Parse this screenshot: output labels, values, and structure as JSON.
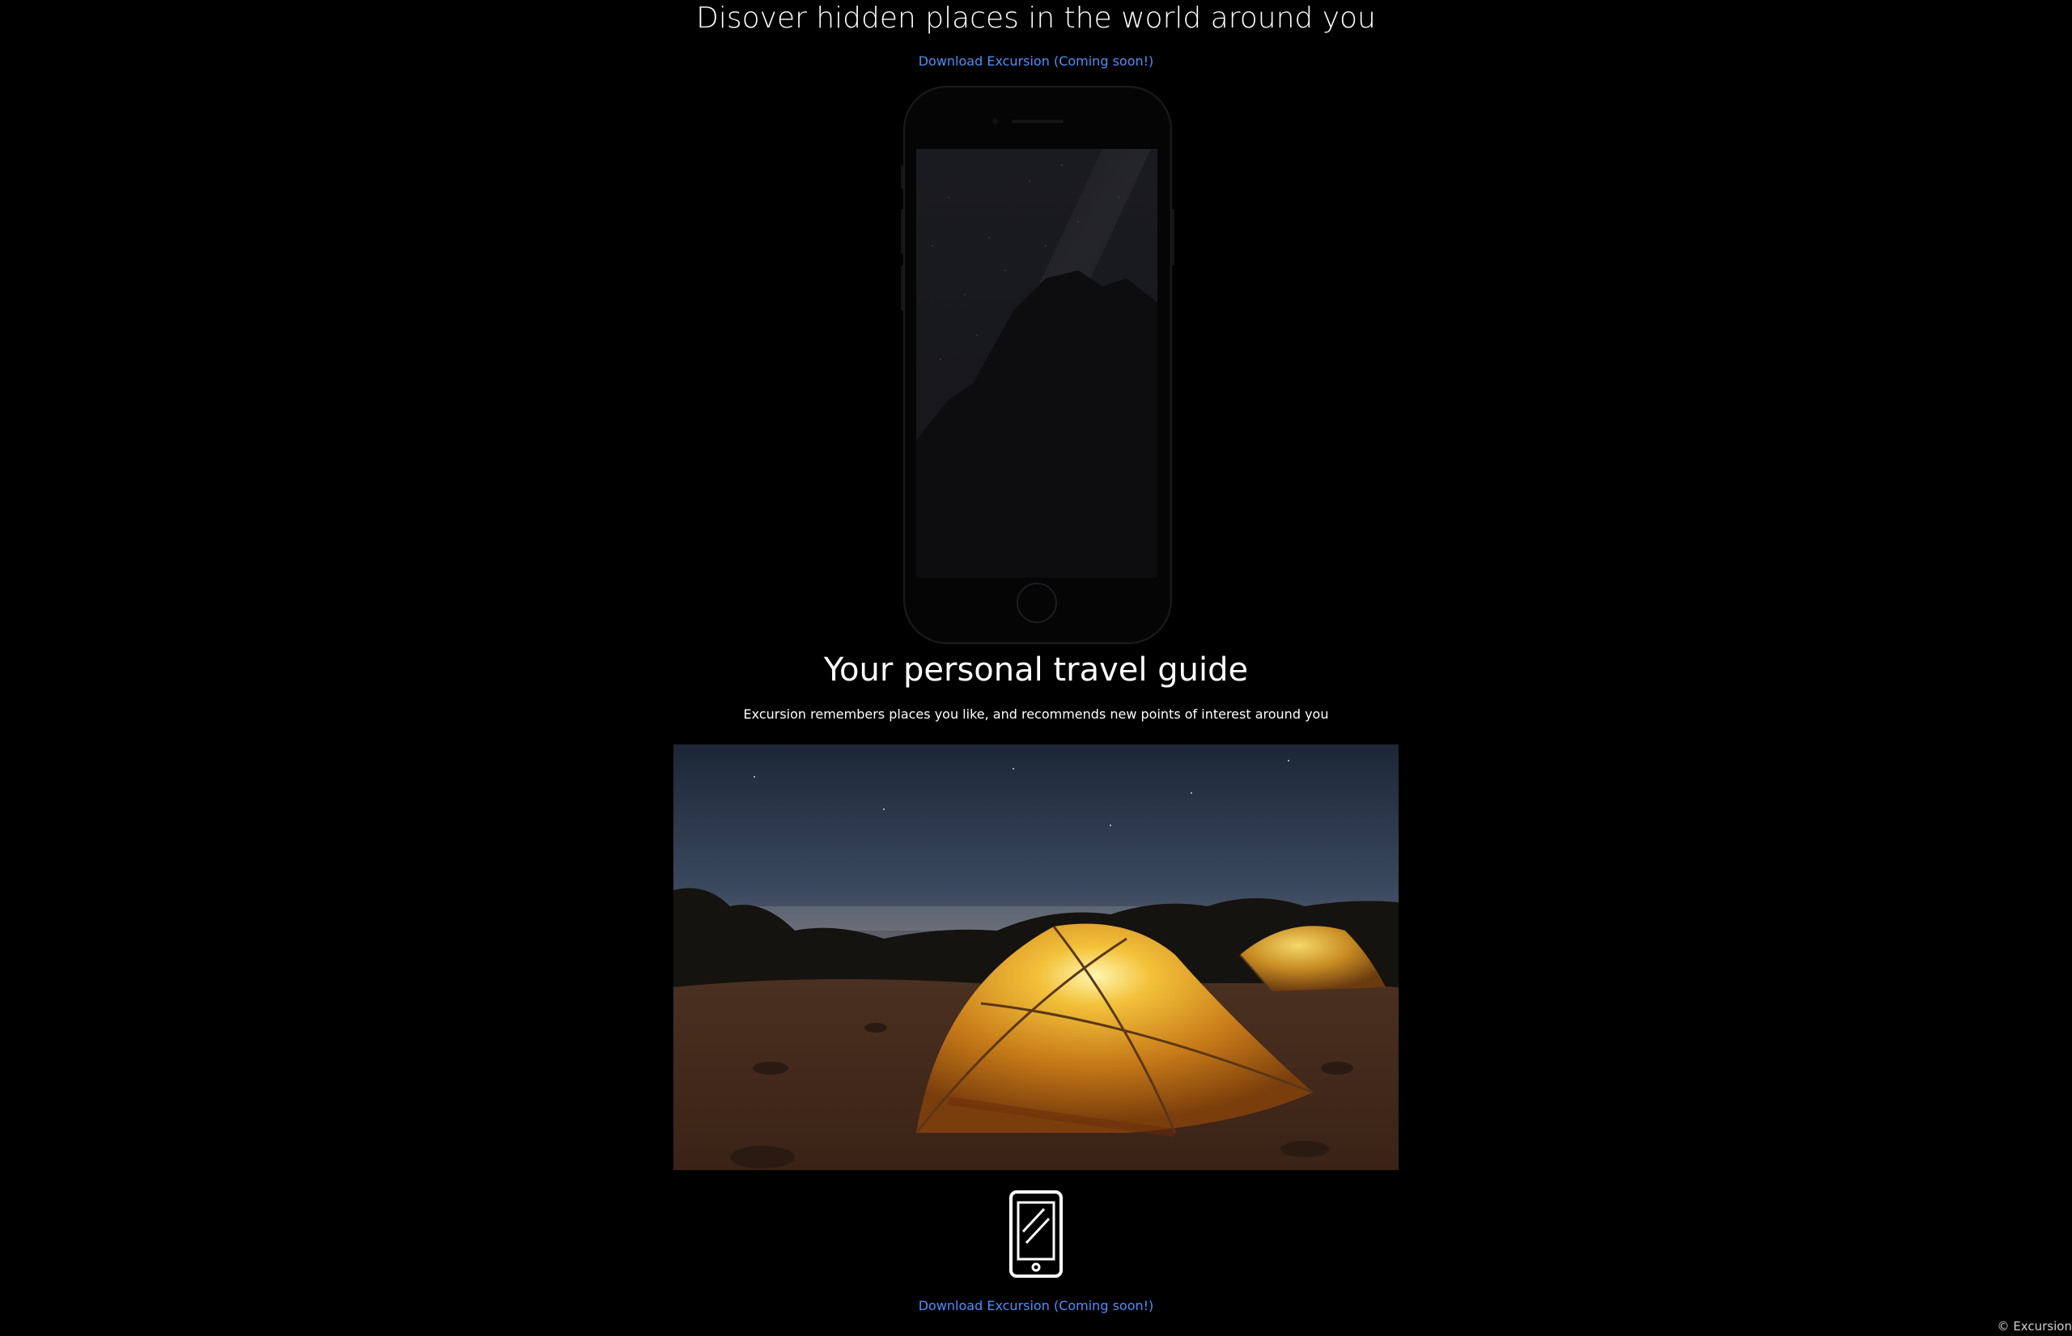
{
  "hero": {
    "title": "Disover hidden places in the world around you",
    "download_link": "Download Excursion (Coming soon!)"
  },
  "feature": {
    "title": "Your personal travel guide",
    "description": "Excursion remembers places you like, and recommends new points of interest around you"
  },
  "footer": {
    "download_link": "Download Excursion (Coming soon!)",
    "copyright": "© Excursion"
  },
  "colors": {
    "background": "#000000",
    "link": "#4d8ff7",
    "text": "#ffffff"
  },
  "icons": {
    "device": "smartphone-icon"
  }
}
